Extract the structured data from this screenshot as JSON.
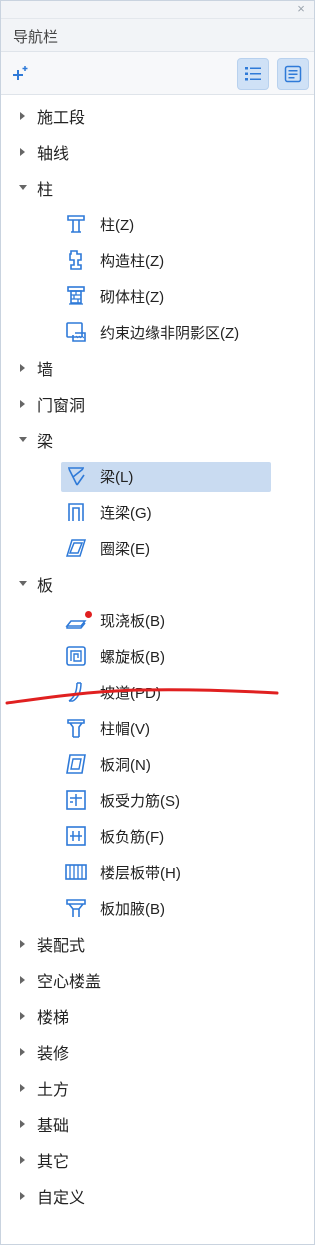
{
  "panel": {
    "close_glyph": "×",
    "title": "导航栏",
    "toolbar": {
      "add_icon": "add-sparkle-icon",
      "list_view_icon": "list-view-icon",
      "detail_view_icon": "detail-view-icon"
    }
  },
  "tree": {
    "items": [
      {
        "label": "施工段",
        "expanded": false
      },
      {
        "label": "轴线",
        "expanded": false
      },
      {
        "label": "柱",
        "expanded": true,
        "children": [
          {
            "label": "柱(Z)",
            "icon": "column-icon"
          },
          {
            "label": "构造柱(Z)",
            "icon": "structural-column-icon"
          },
          {
            "label": "砌体柱(Z)",
            "icon": "masonry-column-icon"
          },
          {
            "label": "约束边缘非阴影区(Z)",
            "icon": "constraint-edge-icon"
          }
        ]
      },
      {
        "label": "墙",
        "expanded": false
      },
      {
        "label": "门窗洞",
        "expanded": false
      },
      {
        "label": "梁",
        "expanded": true,
        "children": [
          {
            "label": "梁(L)",
            "icon": "beam-icon",
            "selected": true
          },
          {
            "label": "连梁(G)",
            "icon": "coupling-beam-icon"
          },
          {
            "label": "圈梁(E)",
            "icon": "ring-beam-icon"
          }
        ]
      },
      {
        "label": "板",
        "expanded": true,
        "children": [
          {
            "label": "现浇板(B)",
            "icon": "cast-slab-icon"
          },
          {
            "label": "螺旋板(B)",
            "icon": "spiral-slab-icon"
          },
          {
            "label": "坡道(PD)",
            "icon": "ramp-icon"
          },
          {
            "label": "柱帽(V)",
            "icon": "column-cap-icon"
          },
          {
            "label": "板洞(N)",
            "icon": "slab-hole-icon"
          },
          {
            "label": "板受力筋(S)",
            "icon": "slab-rebar-icon"
          },
          {
            "label": "板负筋(F)",
            "icon": "negative-rebar-icon"
          },
          {
            "label": "楼层板带(H)",
            "icon": "floor-strip-icon"
          },
          {
            "label": "板加腋(B)",
            "icon": "slab-haunch-icon"
          }
        ]
      },
      {
        "label": "装配式",
        "expanded": false
      },
      {
        "label": "空心楼盖",
        "expanded": false
      },
      {
        "label": "楼梯",
        "expanded": false
      },
      {
        "label": "装修",
        "expanded": false
      },
      {
        "label": "土方",
        "expanded": false
      },
      {
        "label": "基础",
        "expanded": false
      },
      {
        "label": "其它",
        "expanded": false
      },
      {
        "label": "自定义",
        "expanded": false
      }
    ]
  },
  "colors": {
    "icon_blue": "#2f7ad8",
    "selected_bg": "#c9dbf1",
    "annotation_red": "#e02020"
  }
}
